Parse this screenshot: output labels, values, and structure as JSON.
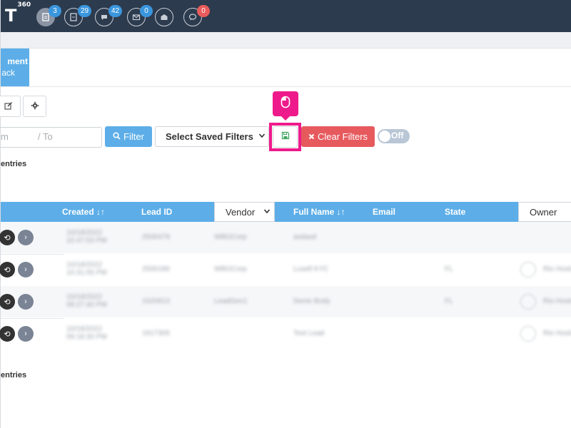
{
  "app": {
    "logo_letter": "T",
    "logo_sup": "360"
  },
  "nav": {
    "icons": [
      {
        "name": "document-icon",
        "badge": "3",
        "badge_color": "#3a96dd",
        "active": true
      },
      {
        "name": "report-icon",
        "badge": "29",
        "badge_color": "#3a96dd"
      },
      {
        "name": "chat-icon",
        "badge": "42",
        "badge_color": "#3a96dd"
      },
      {
        "name": "mail-icon",
        "badge": "0",
        "badge_color": "#3a96dd"
      },
      {
        "name": "open-mail-icon",
        "badge": "",
        "badge_color": ""
      },
      {
        "name": "comment-icon",
        "badge": "0",
        "badge_color": "#e95b5b"
      }
    ]
  },
  "tab": {
    "line1": "ment",
    "line2": "ack"
  },
  "filters": {
    "date_from": "m",
    "date_to": "/  To",
    "filter_label": "Filter",
    "saved_filters_label": "Select Saved Filters",
    "clear_label": "Clear Filters",
    "toggle_label": "Off"
  },
  "entries_top": "entries",
  "entries_bottom": "entries",
  "table": {
    "headers": {
      "created": "Created ↓↑",
      "lead_id": "Lead ID",
      "vendor": "Vendor",
      "full_name": "Full Name ↓↑",
      "email": "Email",
      "state": "State",
      "owner": "Owner"
    },
    "rows": [
      {
        "created": "10/18/2022 10:47:53 PM",
        "lead_id": "2500479",
        "vendor": "WBOCorp",
        "name": "asdasd",
        "state": "",
        "owner": ""
      },
      {
        "created": "10/18/2022 10:31:05 PM",
        "lead_id": "2500186",
        "vendor": "WBOCorp",
        "name": "Lusell KYC",
        "state": "FL",
        "owner": "Rio Hosti"
      },
      {
        "created": "10/18/2022 09:27:40 PM",
        "lead_id": "1520613",
        "vendor": "LeadGen1",
        "name": "Denie Body",
        "state": "FL",
        "owner": "Rio Hosti"
      },
      {
        "created": "10/18/2022 09:18:30 PM",
        "lead_id": "1917305",
        "vendor": "",
        "name": "Test Lead",
        "state": "",
        "owner": "Rio Hosti"
      }
    ]
  },
  "colors": {
    "accent": "#5daee8",
    "danger": "#e65a5e",
    "highlight": "#ee1a8b",
    "topbar": "#2d3b4e"
  }
}
